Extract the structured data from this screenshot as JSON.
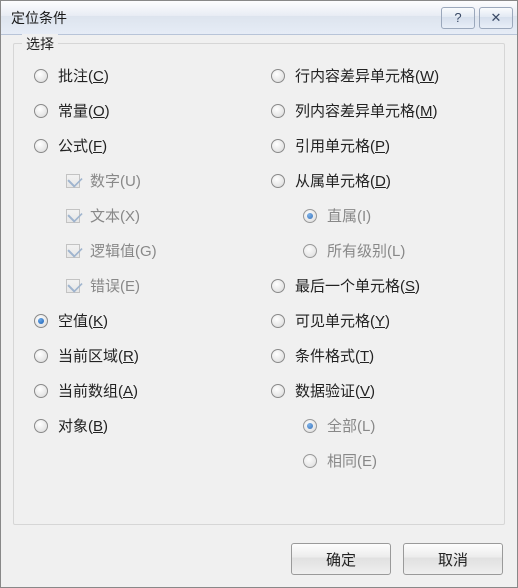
{
  "title": "定位条件",
  "legend": "选择",
  "left": [
    {
      "type": "radio",
      "label": "批注(",
      "key": "C",
      "after": ")",
      "selected": false
    },
    {
      "type": "radio",
      "label": "常量(",
      "key": "O",
      "after": ")",
      "selected": false
    },
    {
      "type": "radio",
      "label": "公式(",
      "key": "F",
      "after": ")",
      "selected": false
    },
    {
      "type": "check",
      "label": "数字(U)",
      "checked": true,
      "indent": true,
      "disabled": true
    },
    {
      "type": "check",
      "label": "文本(X)",
      "checked": true,
      "indent": true,
      "disabled": true
    },
    {
      "type": "check",
      "label": "逻辑值(G)",
      "checked": true,
      "indent": true,
      "disabled": true
    },
    {
      "type": "check",
      "label": "错误(E)",
      "checked": true,
      "indent": true,
      "disabled": true
    },
    {
      "type": "radio",
      "label": "空值(",
      "key": "K",
      "after": ")",
      "selected": true
    },
    {
      "type": "radio",
      "label": "当前区域(",
      "key": "R",
      "after": ")",
      "selected": false
    },
    {
      "type": "radio",
      "label": "当前数组(",
      "key": "A",
      "after": ")",
      "selected": false
    },
    {
      "type": "radio",
      "label": "对象(",
      "key": "B",
      "after": ")",
      "selected": false
    }
  ],
  "right": [
    {
      "type": "radio",
      "label": "行内容差异单元格(",
      "key": "W",
      "after": ")",
      "selected": false
    },
    {
      "type": "radio",
      "label": "列内容差异单元格(",
      "key": "M",
      "after": ")",
      "selected": false
    },
    {
      "type": "radio",
      "label": "引用单元格(",
      "key": "P",
      "after": ")",
      "selected": false
    },
    {
      "type": "radio",
      "label": "从属单元格(",
      "key": "D",
      "after": ")",
      "selected": false
    },
    {
      "type": "radio",
      "label": "直属(I)",
      "selected": true,
      "indent": true,
      "disabled": true
    },
    {
      "type": "radio",
      "label": "所有级别(L)",
      "selected": false,
      "indent": true,
      "disabled": true
    },
    {
      "type": "radio",
      "label": "最后一个单元格(",
      "key": "S",
      "after": ")",
      "selected": false
    },
    {
      "type": "radio",
      "label": "可见单元格(",
      "key": "Y",
      "after": ")",
      "selected": false
    },
    {
      "type": "radio",
      "label": "条件格式(",
      "key": "T",
      "after": ")",
      "selected": false
    },
    {
      "type": "radio",
      "label": "数据验证(",
      "key": "V",
      "after": ")",
      "selected": false
    },
    {
      "type": "radio",
      "label": "全部(L)",
      "selected": true,
      "indent": true,
      "disabled": true
    },
    {
      "type": "radio",
      "label": "相同(E)",
      "selected": false,
      "indent": true,
      "disabled": true
    }
  ],
  "buttons": {
    "ok": "确定",
    "cancel": "取消"
  },
  "help_glyph": "?",
  "close_glyph": "✕"
}
